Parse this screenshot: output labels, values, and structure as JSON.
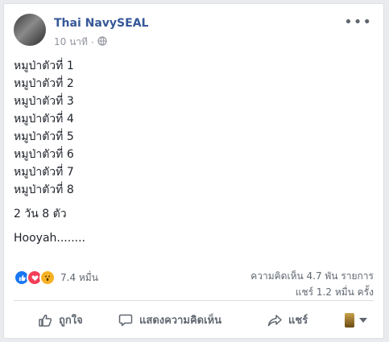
{
  "post": {
    "author": "Thai NavySEAL",
    "time": "10 นาที",
    "separator": "·",
    "more_icon": "more-icon",
    "lines": [
      "หมูป่าตัวที่ 1",
      "หมูป่าตัวที่ 2",
      "หมูป่าตัวที่ 3",
      "หมูป่าตัวที่ 4",
      "หมูป่าตัวที่ 5",
      "หมูป่าตัวที่ 6",
      "หมูป่าตัวที่ 7",
      "หมูป่าตัวที่ 8"
    ],
    "summary": "2 วัน 8 ตัว",
    "signoff": "Hooyah........"
  },
  "stats": {
    "reactions_count": "7.4 หมื่น",
    "comments": "ความคิดเห็น 4.7 พัน รายการ",
    "shares": "แชร์ 1.2 หมื่น ครั้ง"
  },
  "actions": {
    "like": "ถูกใจ",
    "comment": "แสดงความคิดเห็น",
    "share": "แชร์"
  },
  "colors": {
    "author": "#365899",
    "like": "#1877f2",
    "love": "#f33e58",
    "wow": "#f7b125"
  }
}
